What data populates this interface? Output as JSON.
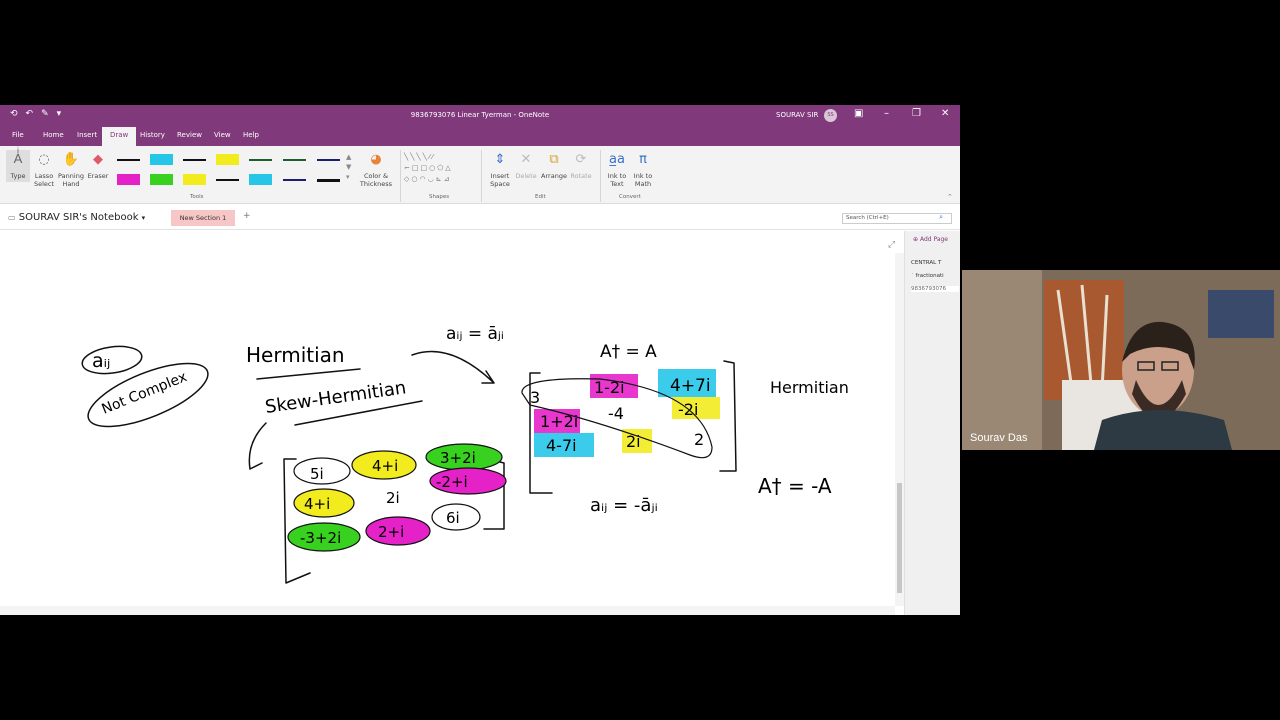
{
  "window": {
    "title": "9836793076  Linear Tyerman - OneNote",
    "user": "SOURAV SIR",
    "avatar_initials": "SS",
    "accent_color": "#80397b"
  },
  "menu": {
    "tabs": [
      "File",
      "Home",
      "Insert",
      "Draw",
      "History",
      "Review",
      "View",
      "Help"
    ],
    "active": "Draw"
  },
  "ribbon": {
    "type_label": "Type",
    "lasso_label": "Lasso Select",
    "panning_label": "Panning Hand",
    "eraser_label": "Eraser",
    "color_thickness_label": "Color & Thickness",
    "tools_group": "Tools",
    "shapes_group": "Shapes",
    "insert_space_label": "Insert Space",
    "delete_label": "Delete",
    "arrange_label": "Arrange",
    "rotate_label": "Rotate",
    "edit_group": "Edit",
    "ink_to_text_label": "Ink to Text",
    "ink_to_math_label": "Ink to Math",
    "convert_group": "Convert",
    "pens": [
      "#111111",
      "#25c6e8",
      "#111111",
      "#f2ec1f",
      "#1d5e2e",
      "#1d5e2e",
      "#1e1e6e",
      "#e521c8",
      "#39d11f",
      "#f2ec1f",
      "#111111",
      "#25c6e8",
      "#1e1e6e",
      "#111111"
    ]
  },
  "notebook": {
    "name": "SOURAV SIR's Notebook",
    "section": "New Section 1",
    "add_section": "+",
    "search_placeholder": "Search (Ctrl+E)"
  },
  "pages_pane": {
    "add_page": "Add Page",
    "pages": [
      "CENTRAL T",
      "` fractionati",
      "9836793076"
    ]
  },
  "ink": {
    "a_ij": "aᵢⱼ",
    "not_complex": "Not Complex",
    "hermitian": "Hermitian",
    "skew_hermitian": "Skew-Hermitian",
    "aij_top": "aᵢⱼ = āⱼᵢ",
    "a_dagger_eq_a": "A† = A",
    "hermitian_right": "Hermitian",
    "a_dagger_eq_minus_a": "A† = -A",
    "aij_skew": "aᵢⱼ = -āⱼᵢ",
    "matrix1": [
      "5i",
      "4+i",
      "3+2i",
      "-2+i",
      "4+i",
      "2i",
      "-3+2i",
      "2+i",
      "6i"
    ],
    "matrix2": [
      "3",
      "1-2i",
      "4+7i",
      "1+2i",
      "-4",
      "-2i",
      "4-7i",
      "2i",
      "2"
    ]
  },
  "video": {
    "presenter": "Sourav Das"
  }
}
